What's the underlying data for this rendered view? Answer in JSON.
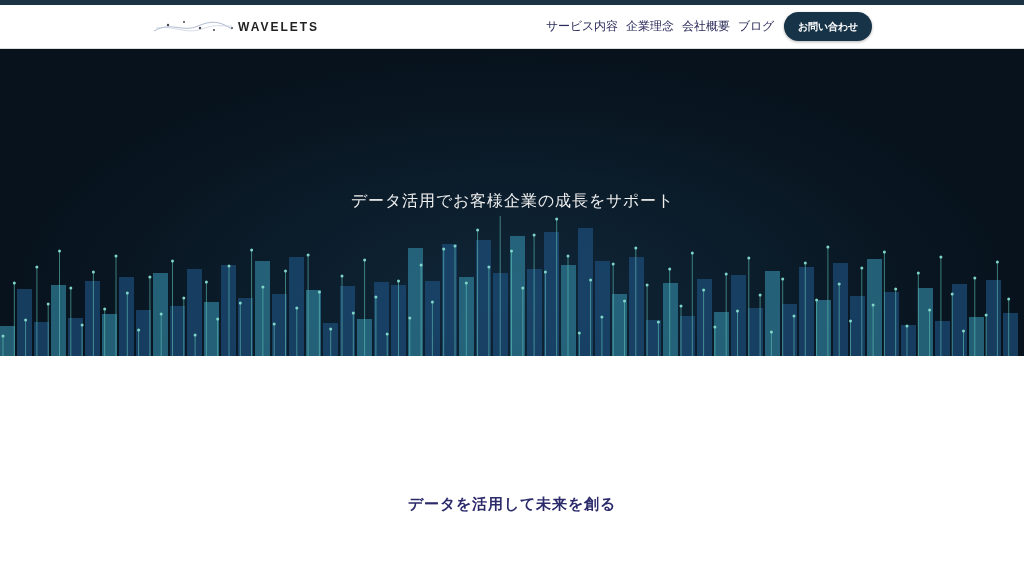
{
  "header": {
    "logo": "WAVELETS",
    "nav": [
      {
        "label": "サービス内容"
      },
      {
        "label": "企業理念"
      },
      {
        "label": "会社概要"
      },
      {
        "label": "ブログ"
      }
    ],
    "contact_button": "お問い合わせ"
  },
  "hero": {
    "tagline": "データ活用でお客様企業の成長をサポート"
  },
  "section": {
    "heading": "データを活用して未来を創る"
  }
}
